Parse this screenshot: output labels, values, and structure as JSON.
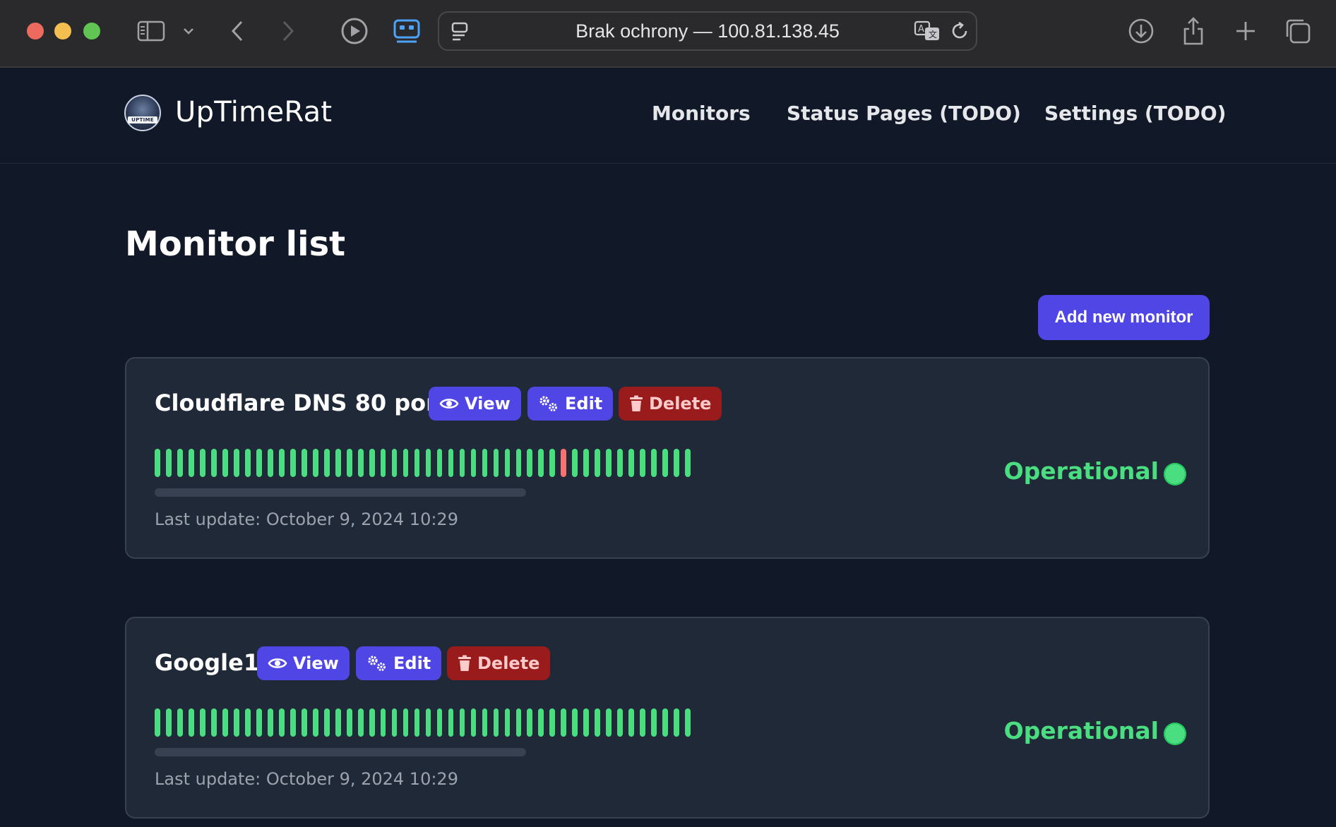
{
  "browser": {
    "url_text": "Brak ochrony — 100.81.138.45",
    "toolbar_icons": [
      "sidebar-icon",
      "chevron-down-icon",
      "back-icon",
      "forward-icon",
      "record-icon",
      "reader-icon",
      "page-menu-icon",
      "translate-icon",
      "reload-icon",
      "download-icon",
      "share-icon",
      "new-tab-icon",
      "tabs-overview-icon"
    ]
  },
  "app": {
    "brand": "UpTimeRat",
    "logo_text": "UPTIME",
    "nav": [
      "Monitors",
      "Status Pages (TODO)",
      "Settings (TODO)"
    ]
  },
  "main": {
    "title": "Monitor list",
    "add_button": "Add new monitor"
  },
  "monitors": [
    {
      "name": "Cloudflare DNS 80 port",
      "view_label": "View",
      "edit_label": "Edit",
      "delete_label": "Delete",
      "status": "Operational",
      "last_update": "Last update: October 9, 2024 10:29",
      "heartbeats": [
        "up",
        "up",
        "up",
        "up",
        "up",
        "up",
        "up",
        "up",
        "up",
        "up",
        "up",
        "up",
        "up",
        "up",
        "up",
        "up",
        "up",
        "up",
        "up",
        "up",
        "up",
        "up",
        "up",
        "up",
        "up",
        "up",
        "up",
        "up",
        "up",
        "up",
        "up",
        "up",
        "up",
        "up",
        "up",
        "up",
        "down",
        "up",
        "up",
        "up",
        "up",
        "up",
        "up",
        "up",
        "up",
        "up",
        "up",
        "up"
      ]
    },
    {
      "name": "Google1",
      "view_label": "View",
      "edit_label": "Edit",
      "delete_label": "Delete",
      "status": "Operational",
      "last_update": "Last update: October 9, 2024 10:29",
      "heartbeats": [
        "up",
        "up",
        "up",
        "up",
        "up",
        "up",
        "up",
        "up",
        "up",
        "up",
        "up",
        "up",
        "up",
        "up",
        "up",
        "up",
        "up",
        "up",
        "up",
        "up",
        "up",
        "up",
        "up",
        "up",
        "up",
        "up",
        "up",
        "up",
        "up",
        "up",
        "up",
        "up",
        "up",
        "up",
        "up",
        "up",
        "up",
        "up",
        "up",
        "up",
        "up",
        "up",
        "up",
        "up",
        "up",
        "up",
        "up",
        "up"
      ]
    }
  ],
  "colors": {
    "accent": "#4f46e5",
    "operational": "#4ade80",
    "down": "#f87171",
    "danger": "#991b1b"
  }
}
